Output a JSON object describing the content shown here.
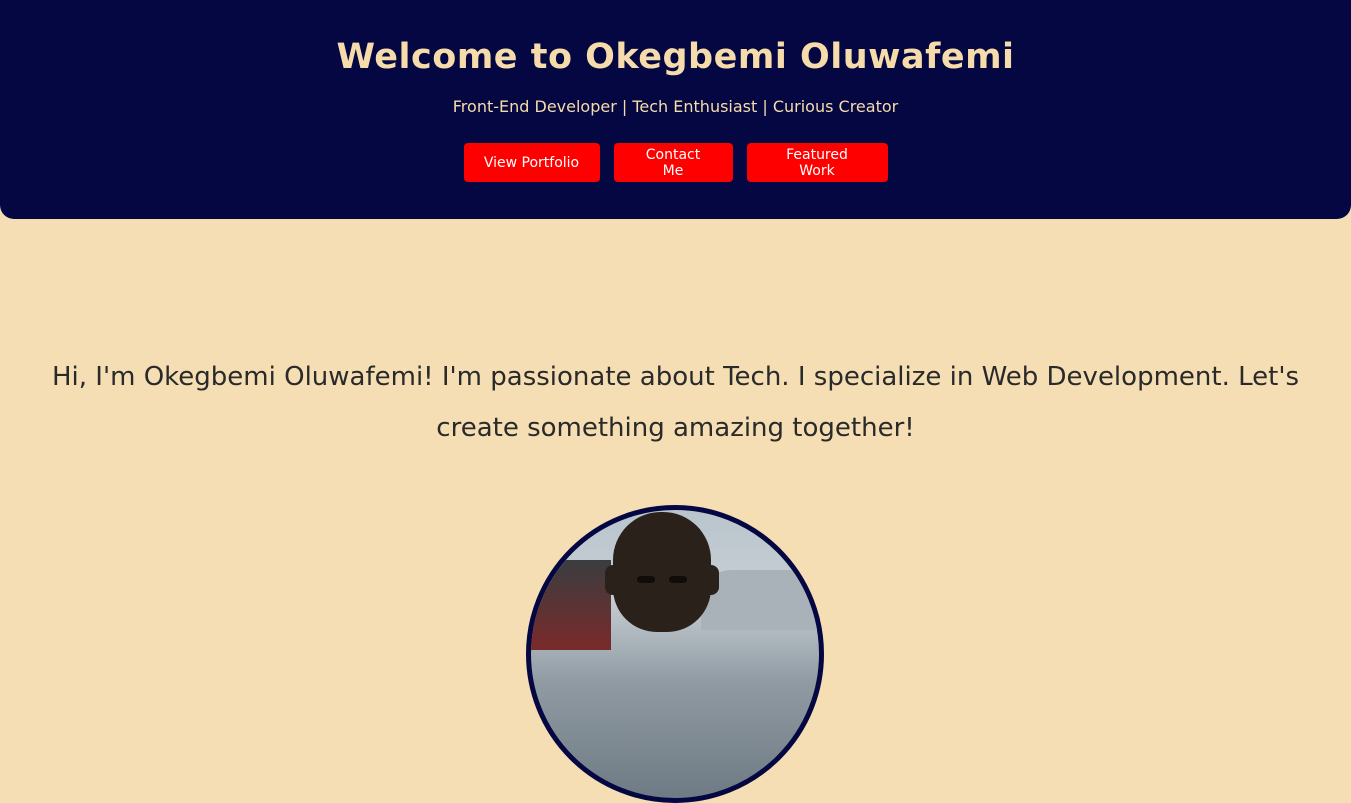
{
  "hero": {
    "title": "Welcome to Okegbemi Oluwafemi",
    "subtitle": "Front-End Developer | Tech Enthusiast | Curious Creator",
    "buttons": {
      "portfolio": "View Portfolio",
      "contact": "Contact Me",
      "featured": "Featured Work"
    }
  },
  "intro": {
    "text": "Hi, I'm Okegbemi Oluwafemi! I'm passionate about Tech. I specialize in Web Development. Let's create something amazing together!"
  },
  "colors": {
    "hero_background": "#040742",
    "page_background": "#f5deb3",
    "title_text": "#f6dcaa",
    "button_background": "#ff0000",
    "button_text": "#ffffff",
    "body_text": "#2a2a2a"
  }
}
